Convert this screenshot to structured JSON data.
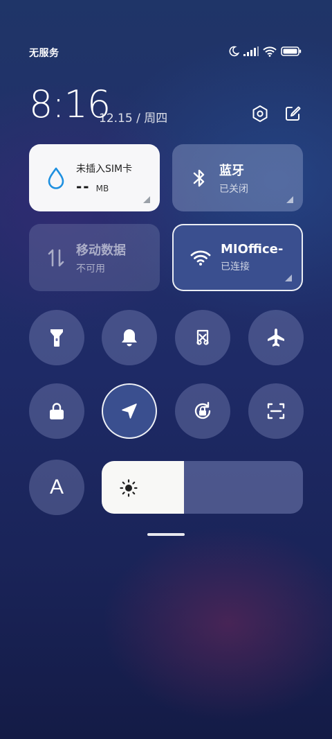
{
  "status_bar": {
    "carrier": "无服务",
    "icons": [
      "moon-icon",
      "signal-icon",
      "wifi-icon",
      "battery-icon"
    ]
  },
  "header": {
    "time": "8:16",
    "date": "12.15 / 周四",
    "icons": [
      "settings-icon",
      "edit-icon"
    ]
  },
  "tiles": {
    "data_usage": {
      "title": "未插入SIM卡",
      "value": "--",
      "unit": "MB",
      "icon": "water-drop-icon"
    },
    "bluetooth": {
      "title": "蓝牙",
      "status": "已关闭",
      "icon": "bluetooth-icon"
    },
    "mobile_data": {
      "title": "移动数据",
      "status": "不可用",
      "icon": "data-arrows-icon"
    },
    "wifi": {
      "title": "MIOffice-",
      "status": "已连接",
      "icon": "wifi-icon"
    }
  },
  "toggles_row1": [
    "flashlight-icon",
    "bell-icon",
    "screenshot-icon",
    "airplane-icon"
  ],
  "toggles_row2": [
    "lock-icon",
    "location-icon",
    "rotation-lock-icon",
    "scan-icon"
  ],
  "font_toggle": {
    "label": "A"
  },
  "brightness": {
    "level": 0.41,
    "icon": "sun-icon"
  },
  "colors": {
    "accent": "#3a4f8f",
    "tile_white": "#f7f7f9",
    "drop_blue": "#1e90e0"
  }
}
